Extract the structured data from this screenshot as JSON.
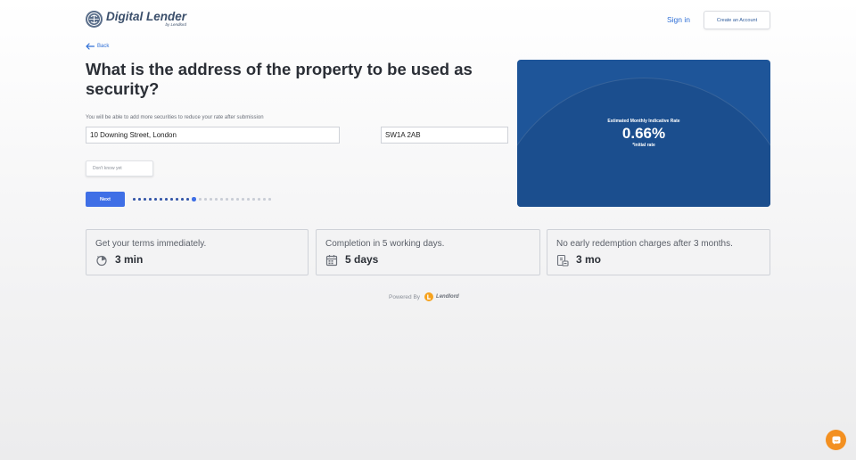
{
  "header": {
    "logo_title": "Digital Lender",
    "logo_sub": "by Lendlord",
    "signin_label": "Sign in",
    "create_account_label": "Create an Account"
  },
  "nav": {
    "back_label": "Back"
  },
  "form": {
    "title": "What is the address of the property to be used as security?",
    "hint": "You will be able to add more securities to reduce your rate after submission",
    "address_value": "10 Downing Street, London",
    "postcode_value": "SW1A 2AB",
    "dont_know_label": "Don't know yet",
    "next_label": "Next",
    "progress": {
      "total_steps": 26,
      "current_step": 12
    }
  },
  "rate_card": {
    "label": "Estimated Monthly Indicative Rate",
    "value": "0.66%",
    "note": "*initial rate"
  },
  "features": [
    {
      "text": "Get your terms immediately.",
      "value": "3 min",
      "icon": "timer-icon"
    },
    {
      "text": "Completion in 5 working days.",
      "value": "5 days",
      "icon": "calendar-icon"
    },
    {
      "text": "No early redemption charges after 3 months.",
      "value": "3 mo",
      "icon": "receipt-icon"
    }
  ],
  "footer": {
    "powered_label": "Powered By",
    "powered_brand": "Lendlord"
  },
  "colors": {
    "accent_blue": "#3f6fe6",
    "card_blue": "#1e5599",
    "chat_orange": "#f39021"
  }
}
